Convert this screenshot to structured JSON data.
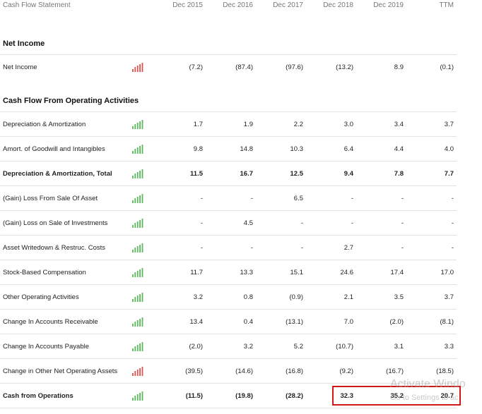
{
  "header": {
    "title": "Cash Flow Statement",
    "columns": [
      "Dec 2015",
      "Dec 2016",
      "Dec 2017",
      "Dec 2018",
      "Dec 2019",
      "TTM"
    ]
  },
  "sections": [
    {
      "title": "Net Income"
    },
    {
      "title": "Cash Flow From Operating Activities"
    }
  ],
  "rows": [
    {
      "label": "Net Income",
      "bold": false,
      "spark_color": "#d9534f",
      "values": [
        "(7.2)",
        "(87.4)",
        "(97.6)",
        "(13.2)",
        "8.9",
        "(0.1)"
      ]
    },
    {
      "label": "Depreciation & Amortization",
      "bold": false,
      "spark_color": "#5cb85c",
      "values": [
        "1.7",
        "1.9",
        "2.2",
        "3.0",
        "3.4",
        "3.7"
      ]
    },
    {
      "label": "Amort. of Goodwill and Intangibles",
      "bold": false,
      "spark_color": "#5cb85c",
      "values": [
        "9.8",
        "14.8",
        "10.3",
        "6.4",
        "4.4",
        "4.0"
      ]
    },
    {
      "label": "Depreciation & Amortization, Total",
      "bold": true,
      "spark_color": "#5cb85c",
      "values": [
        "11.5",
        "16.7",
        "12.5",
        "9.4",
        "7.8",
        "7.7"
      ]
    },
    {
      "label": "(Gain) Loss From Sale Of Asset",
      "bold": false,
      "spark_color": "#5cb85c",
      "values": [
        "-",
        "-",
        "6.5",
        "-",
        "-",
        "-"
      ]
    },
    {
      "label": "(Gain) Loss on Sale of Investments",
      "bold": false,
      "spark_color": "#5cb85c",
      "values": [
        "-",
        "4.5",
        "-",
        "-",
        "-",
        "-"
      ]
    },
    {
      "label": "Asset Writedown & Restruc. Costs",
      "bold": false,
      "spark_color": "#5cb85c",
      "values": [
        "-",
        "-",
        "-",
        "2.7",
        "-",
        "-"
      ]
    },
    {
      "label": "Stock-Based Compensation",
      "bold": false,
      "spark_color": "#5cb85c",
      "values": [
        "11.7",
        "13.3",
        "15.1",
        "24.6",
        "17.4",
        "17.0"
      ]
    },
    {
      "label": "Other Operating Activities",
      "bold": false,
      "spark_color": "#5cb85c",
      "values": [
        "3.2",
        "0.8",
        "(0.9)",
        "2.1",
        "3.5",
        "3.7"
      ]
    },
    {
      "label": "Change In Accounts Receivable",
      "bold": false,
      "spark_color": "#5cb85c",
      "values": [
        "13.4",
        "0.4",
        "(13.1)",
        "7.0",
        "(2.0)",
        "(8.1)"
      ]
    },
    {
      "label": "Change In Accounts Payable",
      "bold": false,
      "spark_color": "#5cb85c",
      "values": [
        "(2.0)",
        "3.2",
        "5.2",
        "(10.7)",
        "3.1",
        "3.3"
      ]
    },
    {
      "label": "Change in Other Net Operating Assets",
      "bold": false,
      "spark_color": "#d9534f",
      "values": [
        "(39.5)",
        "(14.6)",
        "(16.8)",
        "(9.2)",
        "(16.7)",
        "(18.5)"
      ]
    },
    {
      "label": "Cash from Operations",
      "bold": true,
      "spark_color": "#5cb85c",
      "values": [
        "(11.5)",
        "(19.8)",
        "(28.2)",
        "32.3",
        "35.2",
        "20.7"
      ]
    }
  ],
  "watermark": {
    "line1": "Activate Windo",
    "line2": "Go to Settings to ac"
  },
  "colors": {
    "positive": "#5cb85c",
    "negative": "#d9534f",
    "highlight": "#d01818"
  }
}
